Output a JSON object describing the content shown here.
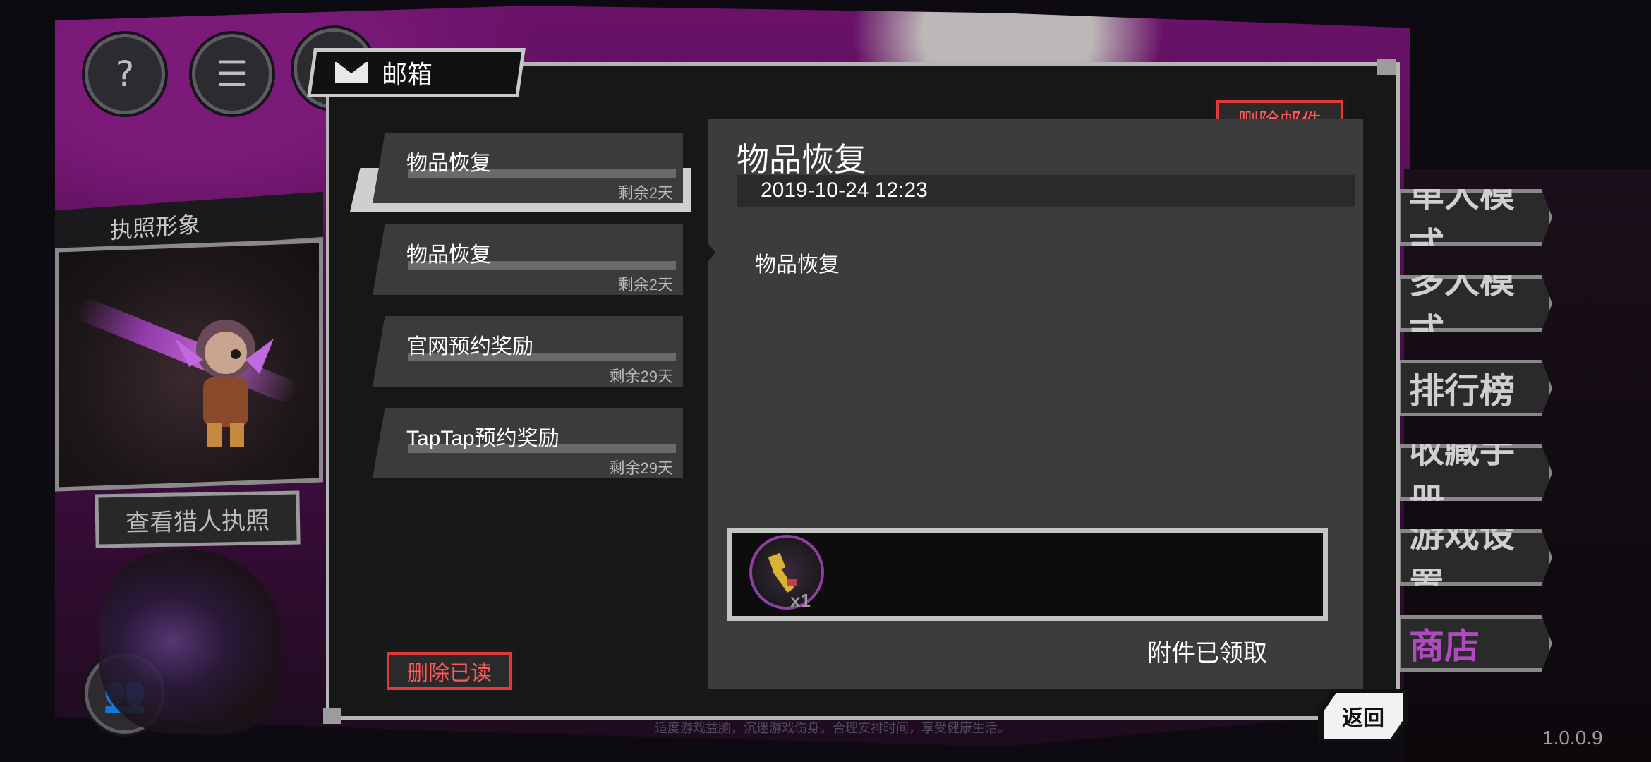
{
  "background": {
    "license_title": "执照形象",
    "view_license_button": "查看猎人执照",
    "side_menu": [
      "单人模式",
      "多人模式",
      "排行榜",
      "收藏手册",
      "游戏设置",
      "商店"
    ],
    "footer_tip": "适度游戏益脑，沉迷游戏伤身。合理安排时间，享受健康生活。",
    "version": "1.0.0.9"
  },
  "dialog": {
    "title": "邮箱",
    "delete_mail_label": "删除邮件",
    "delete_read_label": "删除已读",
    "back_label": "返回"
  },
  "mail_list": [
    {
      "subject": "物品恢复",
      "remaining": "剩余2天",
      "selected": true
    },
    {
      "subject": "物品恢复",
      "remaining": "剩余2天",
      "selected": false
    },
    {
      "subject": "官网预约奖励",
      "remaining": "剩余29天",
      "selected": false
    },
    {
      "subject": "TapTap预约奖励",
      "remaining": "剩余29天",
      "selected": false
    }
  ],
  "detail": {
    "title": "物品恢复",
    "date": "2019-10-24 12:23",
    "body": "物品恢复",
    "attachments": [
      {
        "icon": "key-icon",
        "quantity": "x1"
      }
    ],
    "status": "附件已领取"
  },
  "colors": {
    "accent_red": "#e23a3a",
    "purple_bg": "#6a1269",
    "attachment_ring": "#8e3fa0"
  }
}
